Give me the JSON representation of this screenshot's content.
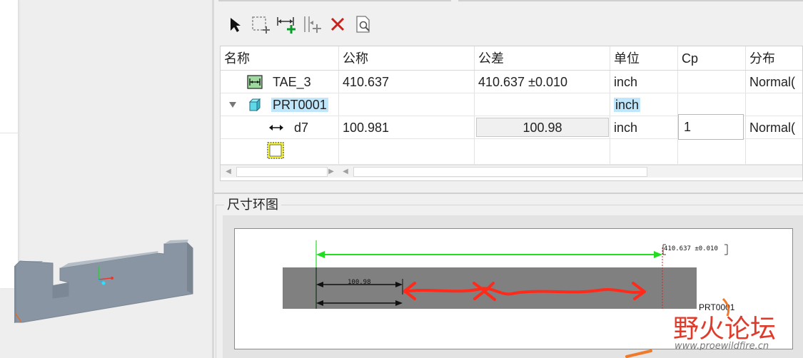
{
  "toolbar": {
    "buttons": [
      {
        "id": "select",
        "icon": "arrow-pointer-icon"
      },
      {
        "id": "add-component",
        "icon": "add-component-icon"
      },
      {
        "id": "add-dimension",
        "icon": "add-dimension-icon"
      },
      {
        "id": "insert-column",
        "icon": "insert-column-icon"
      },
      {
        "id": "delete",
        "icon": "red-x-delete-icon"
      },
      {
        "id": "preview",
        "icon": "document-search-icon"
      }
    ]
  },
  "table": {
    "columns": [
      "名称",
      "公称",
      "公差",
      "单位",
      "Cp",
      "分布"
    ],
    "rows": [
      {
        "name": "TAE_3",
        "nominal": "410.637",
        "tolerance": "410.637 ±0.010",
        "unit": "inch",
        "cp": "",
        "distribution": "Normal(",
        "icon": "tolerance-analysis-icon"
      },
      {
        "name": "PRT0001",
        "nominal": "",
        "tolerance": "",
        "unit": "inch",
        "cp": "",
        "distribution": "",
        "icon": "part-cube-icon",
        "expanded": true,
        "selected": true
      },
      {
        "name": "d7",
        "nominal": "100.981",
        "tolerance": "100.98",
        "unit": "inch",
        "cp": "1",
        "distribution": "Normal(",
        "icon": "linear-dimension-icon"
      },
      {
        "name": "",
        "icon": "placeholder-dashed-icon"
      }
    ]
  },
  "section": {
    "title": "尺寸环图"
  },
  "diagram": {
    "dim_total_label": "410.637 ±0.010",
    "dim_part_label": "100.98",
    "part_label": "PRT0001"
  },
  "watermark": {
    "main": "野火论坛",
    "url": "www.proewildfire.cn"
  },
  "colors": {
    "accent_green": "#22dd22",
    "selection": "#bfe6fb",
    "annotation_red": "#ff2a1a",
    "bar_gray": "#808080",
    "model_gray": "#8a96a3"
  }
}
